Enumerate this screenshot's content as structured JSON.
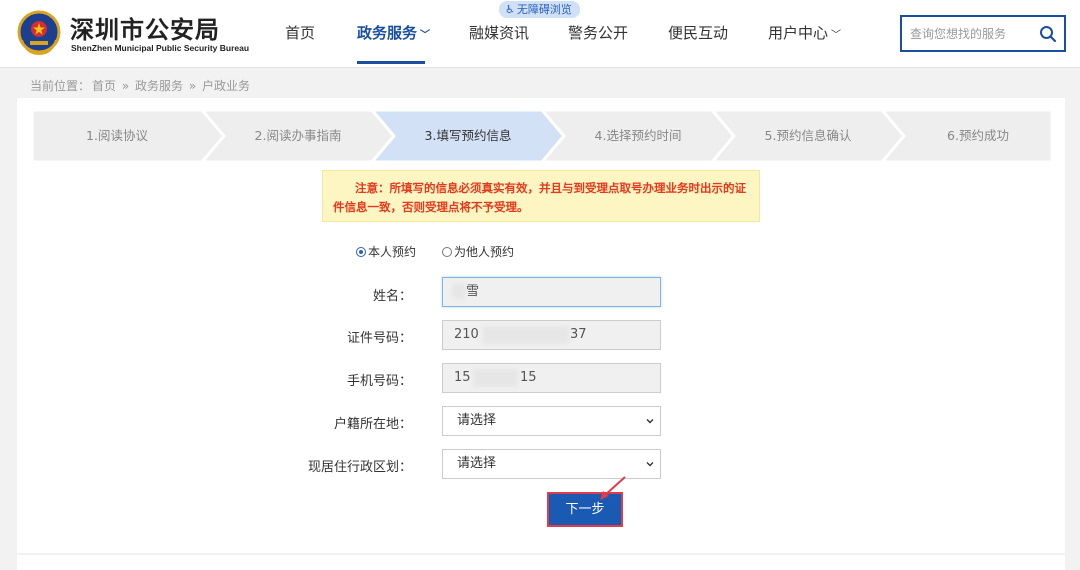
{
  "header": {
    "brand_title": "深圳市公安局",
    "brand_subtitle": "ShenZhen Municipal Public Security Bureau",
    "accessibility_badge": "无障碍浏览",
    "nav": [
      {
        "label": "首页"
      },
      {
        "label": "政务服务",
        "active": true,
        "has_dropdown": true
      },
      {
        "label": "融媒资讯"
      },
      {
        "label": "警务公开"
      },
      {
        "label": "便民互动"
      },
      {
        "label": "用户中心",
        "has_dropdown": true
      }
    ],
    "search_placeholder": "查询您想找的服务",
    "colors": {
      "primary": "#1a4fa0",
      "badge_bg": "#cfe0f7"
    }
  },
  "breadcrumb": {
    "prefix": "当前位置：",
    "items": [
      "首页",
      "政务服务",
      "户政业务"
    ],
    "separator": "»"
  },
  "steps": {
    "current_index": 2,
    "items": [
      "1.阅读协议",
      "2.阅读办事指南",
      "3.填写预约信息",
      "4.选择预约时间",
      "5.预约信息确认",
      "6.预约成功"
    ],
    "colors": {
      "inactive": "#eeeeee",
      "current": "#d3e1f6"
    }
  },
  "notice": {
    "text": "注意：所填写的信息必须真实有效，并且与到受理点取号办理业务时出示的证件信息一致，否则受理点将不予受理。",
    "colors": {
      "bg": "#fdf6c3",
      "text": "#e8381c"
    }
  },
  "form": {
    "booking_options": [
      {
        "label": "本人预约",
        "checked": true
      },
      {
        "label": "为他人预约",
        "checked": false
      }
    ],
    "name": {
      "label": "姓名：",
      "value": "雪"
    },
    "id_number": {
      "label": "证件号码：",
      "value_start": "210",
      "value_end": "37"
    },
    "phone": {
      "label": "手机号码：",
      "value_start": "15",
      "value_end": "15"
    },
    "household_location": {
      "label": "户籍所在地：",
      "selected": "请选择"
    },
    "residence_district": {
      "label": "现居住行政区划：",
      "selected": "请选择"
    },
    "next_button": "下一步",
    "colors": {
      "button": "#1a5ab2",
      "highlight": "#e23b4a"
    }
  }
}
